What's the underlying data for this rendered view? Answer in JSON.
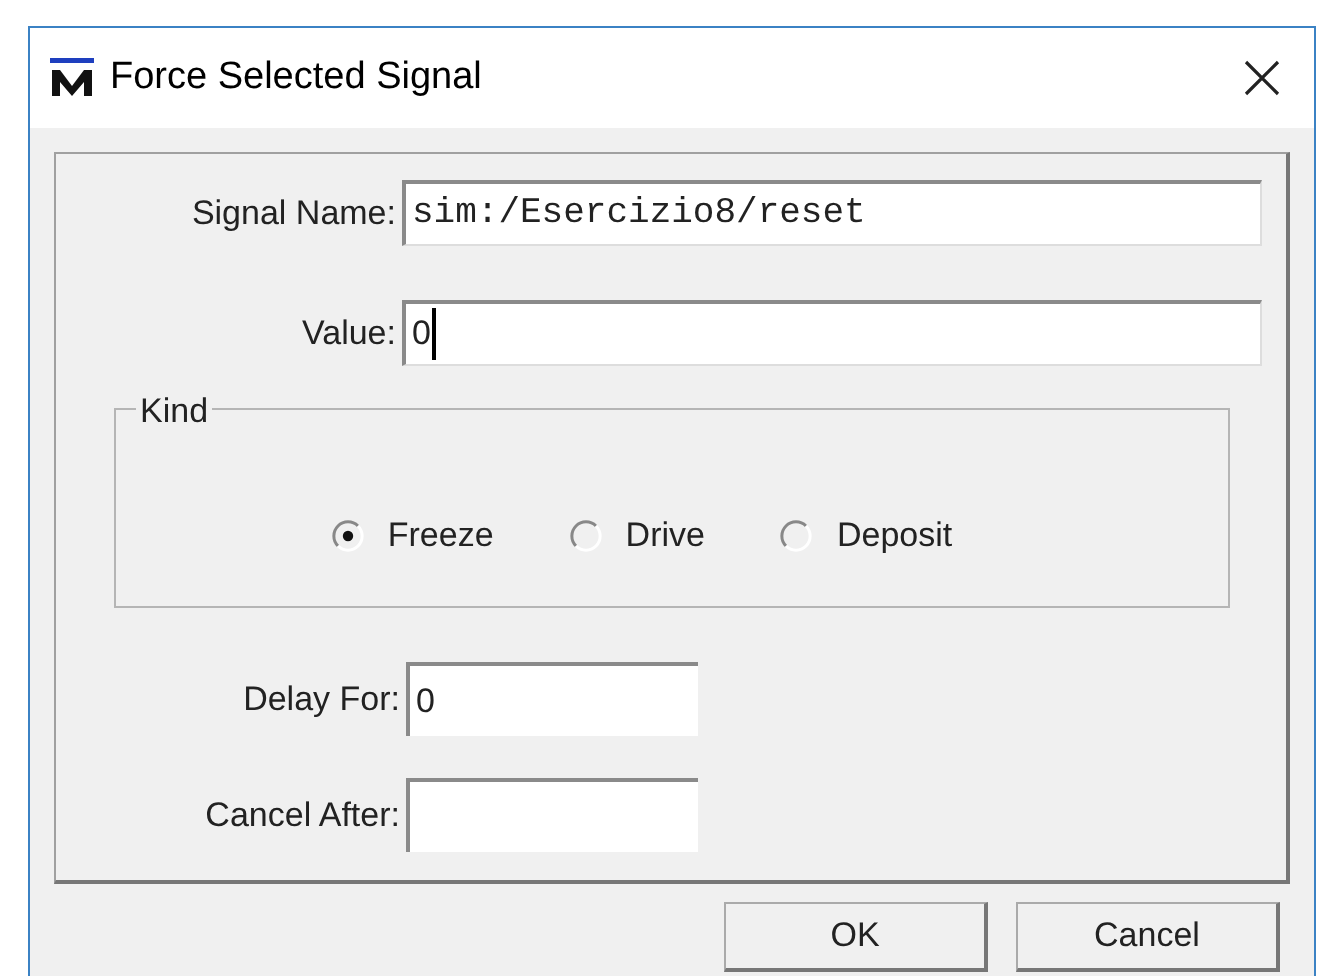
{
  "window": {
    "title": "Force Selected Signal"
  },
  "signal_name": {
    "label": "Signal Name:",
    "value": "sim:/Esercizio8/reset"
  },
  "value": {
    "label": "Value:",
    "value": "0"
  },
  "kind": {
    "label": "Kind",
    "options": [
      {
        "label": "Freeze",
        "selected": true
      },
      {
        "label": "Drive",
        "selected": false
      },
      {
        "label": "Deposit",
        "selected": false
      }
    ]
  },
  "delay_for": {
    "label": "Delay For:",
    "value": "0"
  },
  "cancel_after": {
    "label": "Cancel After:"
  },
  "buttons": [
    "OK",
    "Cancel"
  ]
}
